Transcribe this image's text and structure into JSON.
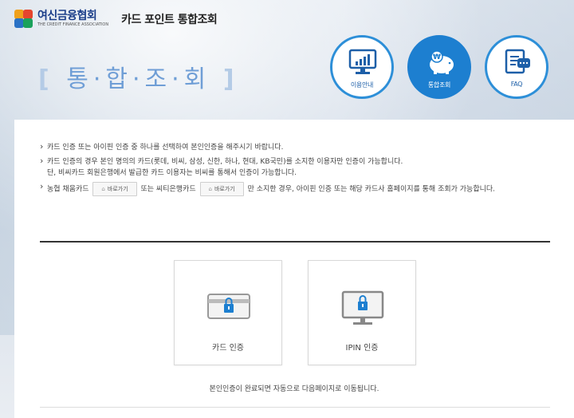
{
  "header": {
    "org_name": "여신금융협회",
    "org_eng": "THE CREDIT FINANCE ASSOCIATION",
    "service_title": "카드 포인트 통합조회"
  },
  "page": {
    "title_left_bracket": "[",
    "title": "통·합·조·회",
    "title_right_bracket": "]"
  },
  "nav": [
    {
      "label": "이용안내",
      "icon": "monitor-chart-icon"
    },
    {
      "label": "통합조회",
      "icon": "piggy-bank-won-icon",
      "active": true
    },
    {
      "label": "FAQ",
      "icon": "document-chat-icon"
    }
  ],
  "notes": {
    "line1": "카드 인증 또는 아이핀 인증 중 하나를 선택하여 본인인증을 해주시기 바랍니다.",
    "line2a": "카드 인증의 경우 본인 명의의 카드(롯데, 비씨, 삼성, 신한, 하나, 현대, KB국민)를 소지한 이용자만 인증이 가능합니다.",
    "line2b": "단, 비씨카드 회원은행에서 발급한 카드 이용자는 비씨를 통해서 인증이 가능합니다.",
    "line3_part1": "농협 채움카드",
    "goto_label": "바로가기",
    "line3_part2": "또는 씨티은행카드",
    "line3_part3": "만 소지한 경우, 아이핀 인증 또는 해당 카드사 홈페이지를 통해 조회가 가능합니다."
  },
  "auth": {
    "card_label": "카드 인증",
    "ipin_label": "IPIN 인증",
    "complete_msg": "본인인증이 완료되면 자동으로 다음페이지로 이동됩니다."
  },
  "colors": {
    "accent": "#1d7fd0",
    "title": "#6f9ed6"
  }
}
